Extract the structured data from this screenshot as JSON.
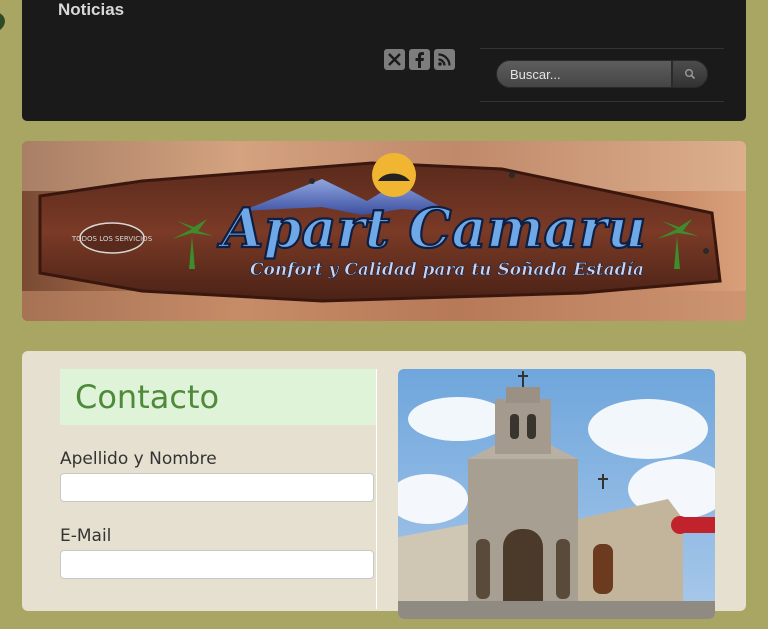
{
  "nav": {
    "noticias": "Noticias"
  },
  "social": {
    "icons": [
      "twitter-icon",
      "facebook-icon",
      "rss-icon"
    ]
  },
  "search": {
    "placeholder": "Buscar...",
    "icon": "search-icon"
  },
  "banner": {
    "title": "Apart Camaru",
    "tagline": "Confort y Calidad para tu Soñada Estadía",
    "badge": "TODOS LOS SERVICIOS"
  },
  "contact": {
    "title": "Contacto",
    "name_label": "Apellido y Nombre",
    "email_label": "E-Mail"
  },
  "colors": {
    "page_bg": "#a8a662",
    "topbar_bg": "#1a1a1a",
    "content_bg": "#e5e0cf",
    "title_bg": "#dff3d9",
    "title_text": "#4f8a3b"
  }
}
